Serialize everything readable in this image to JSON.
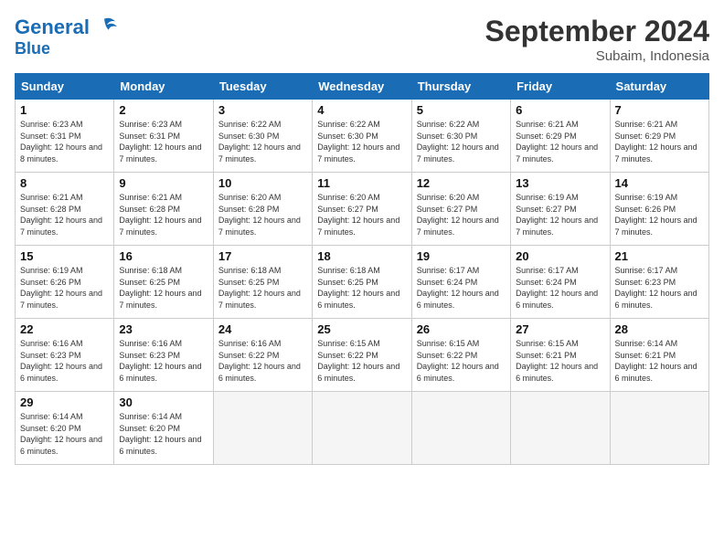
{
  "logo": {
    "line1": "General",
    "line2": "Blue"
  },
  "title": "September 2024",
  "subtitle": "Subaim, Indonesia",
  "headers": [
    "Sunday",
    "Monday",
    "Tuesday",
    "Wednesday",
    "Thursday",
    "Friday",
    "Saturday"
  ],
  "weeks": [
    [
      {
        "day": "1",
        "sunrise": "6:23 AM",
        "sunset": "6:31 PM",
        "daylight": "12 hours and 8 minutes."
      },
      {
        "day": "2",
        "sunrise": "6:23 AM",
        "sunset": "6:31 PM",
        "daylight": "12 hours and 7 minutes."
      },
      {
        "day": "3",
        "sunrise": "6:22 AM",
        "sunset": "6:30 PM",
        "daylight": "12 hours and 7 minutes."
      },
      {
        "day": "4",
        "sunrise": "6:22 AM",
        "sunset": "6:30 PM",
        "daylight": "12 hours and 7 minutes."
      },
      {
        "day": "5",
        "sunrise": "6:22 AM",
        "sunset": "6:30 PM",
        "daylight": "12 hours and 7 minutes."
      },
      {
        "day": "6",
        "sunrise": "6:21 AM",
        "sunset": "6:29 PM",
        "daylight": "12 hours and 7 minutes."
      },
      {
        "day": "7",
        "sunrise": "6:21 AM",
        "sunset": "6:29 PM",
        "daylight": "12 hours and 7 minutes."
      }
    ],
    [
      {
        "day": "8",
        "sunrise": "6:21 AM",
        "sunset": "6:28 PM",
        "daylight": "12 hours and 7 minutes."
      },
      {
        "day": "9",
        "sunrise": "6:21 AM",
        "sunset": "6:28 PM",
        "daylight": "12 hours and 7 minutes."
      },
      {
        "day": "10",
        "sunrise": "6:20 AM",
        "sunset": "6:28 PM",
        "daylight": "12 hours and 7 minutes."
      },
      {
        "day": "11",
        "sunrise": "6:20 AM",
        "sunset": "6:27 PM",
        "daylight": "12 hours and 7 minutes."
      },
      {
        "day": "12",
        "sunrise": "6:20 AM",
        "sunset": "6:27 PM",
        "daylight": "12 hours and 7 minutes."
      },
      {
        "day": "13",
        "sunrise": "6:19 AM",
        "sunset": "6:27 PM",
        "daylight": "12 hours and 7 minutes."
      },
      {
        "day": "14",
        "sunrise": "6:19 AM",
        "sunset": "6:26 PM",
        "daylight": "12 hours and 7 minutes."
      }
    ],
    [
      {
        "day": "15",
        "sunrise": "6:19 AM",
        "sunset": "6:26 PM",
        "daylight": "12 hours and 7 minutes."
      },
      {
        "day": "16",
        "sunrise": "6:18 AM",
        "sunset": "6:25 PM",
        "daylight": "12 hours and 7 minutes."
      },
      {
        "day": "17",
        "sunrise": "6:18 AM",
        "sunset": "6:25 PM",
        "daylight": "12 hours and 7 minutes."
      },
      {
        "day": "18",
        "sunrise": "6:18 AM",
        "sunset": "6:25 PM",
        "daylight": "12 hours and 6 minutes."
      },
      {
        "day": "19",
        "sunrise": "6:17 AM",
        "sunset": "6:24 PM",
        "daylight": "12 hours and 6 minutes."
      },
      {
        "day": "20",
        "sunrise": "6:17 AM",
        "sunset": "6:24 PM",
        "daylight": "12 hours and 6 minutes."
      },
      {
        "day": "21",
        "sunrise": "6:17 AM",
        "sunset": "6:23 PM",
        "daylight": "12 hours and 6 minutes."
      }
    ],
    [
      {
        "day": "22",
        "sunrise": "6:16 AM",
        "sunset": "6:23 PM",
        "daylight": "12 hours and 6 minutes."
      },
      {
        "day": "23",
        "sunrise": "6:16 AM",
        "sunset": "6:23 PM",
        "daylight": "12 hours and 6 minutes."
      },
      {
        "day": "24",
        "sunrise": "6:16 AM",
        "sunset": "6:22 PM",
        "daylight": "12 hours and 6 minutes."
      },
      {
        "day": "25",
        "sunrise": "6:15 AM",
        "sunset": "6:22 PM",
        "daylight": "12 hours and 6 minutes."
      },
      {
        "day": "26",
        "sunrise": "6:15 AM",
        "sunset": "6:22 PM",
        "daylight": "12 hours and 6 minutes."
      },
      {
        "day": "27",
        "sunrise": "6:15 AM",
        "sunset": "6:21 PM",
        "daylight": "12 hours and 6 minutes."
      },
      {
        "day": "28",
        "sunrise": "6:14 AM",
        "sunset": "6:21 PM",
        "daylight": "12 hours and 6 minutes."
      }
    ],
    [
      {
        "day": "29",
        "sunrise": "6:14 AM",
        "sunset": "6:20 PM",
        "daylight": "12 hours and 6 minutes."
      },
      {
        "day": "30",
        "sunrise": "6:14 AM",
        "sunset": "6:20 PM",
        "daylight": "12 hours and 6 minutes."
      },
      null,
      null,
      null,
      null,
      null
    ]
  ]
}
